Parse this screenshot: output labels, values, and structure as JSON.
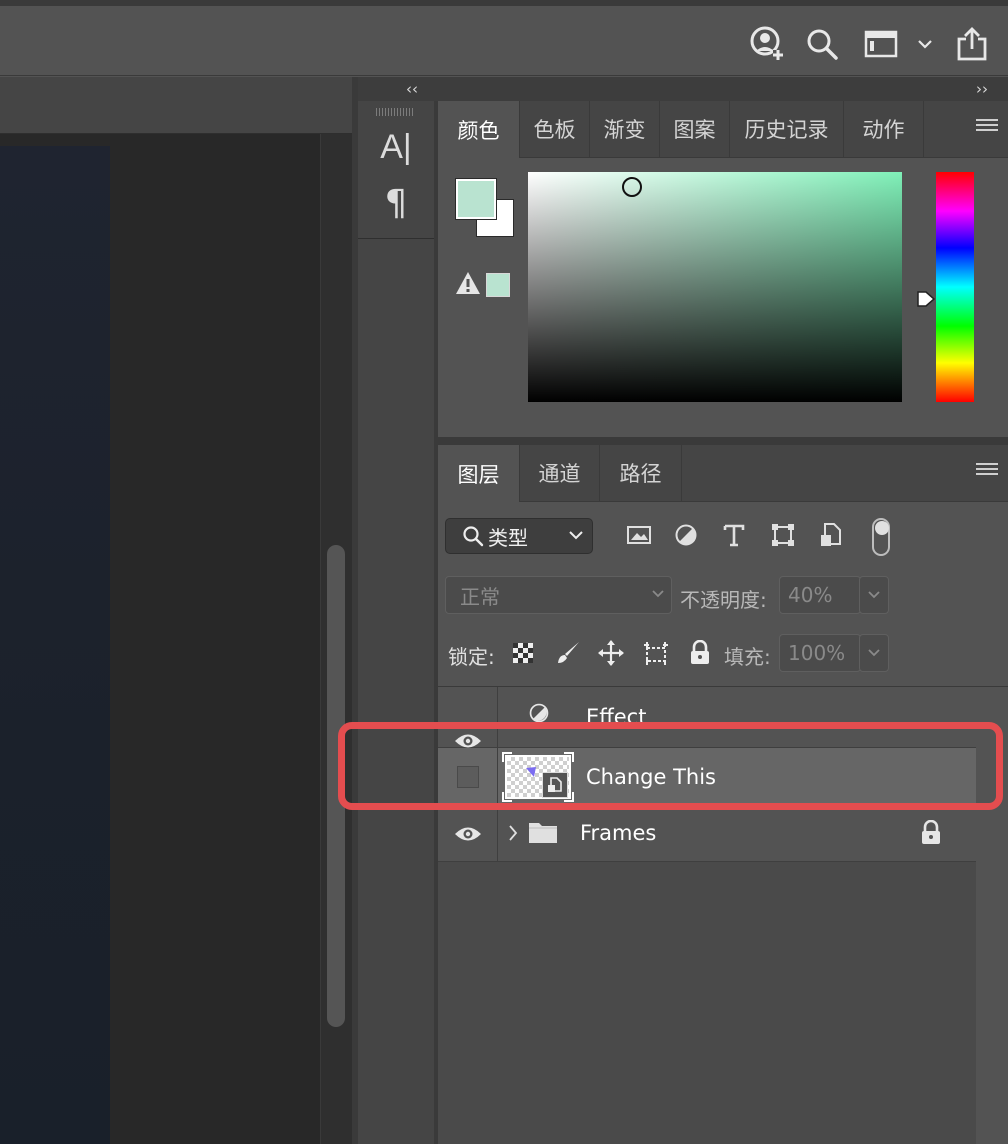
{
  "topbar": {
    "icons": [
      "user-add-icon",
      "search-icon",
      "workspace-icon",
      "chevron-down-icon",
      "share-icon"
    ]
  },
  "collapse": {
    "left": "‹‹",
    "right": "››"
  },
  "mini_panel": {
    "char_icon": "A|",
    "para_icon": "¶"
  },
  "color_panel": {
    "tabs": [
      "颜色",
      "色板",
      "渐变",
      "图案",
      "历史记录",
      "动作"
    ],
    "active_tab": "颜色",
    "foreground_color": "#b9e3d0",
    "background_color": "#ffffff",
    "hue_color": "#7ff0b8"
  },
  "layers_panel": {
    "tabs": [
      "图层",
      "通道",
      "路径"
    ],
    "active_tab": "图层",
    "filter_label": "类型",
    "filter_icons": [
      "image-filter-icon",
      "adjustment-filter-icon",
      "type-filter-icon",
      "shape-filter-icon",
      "smart-object-filter-icon"
    ],
    "blend_mode": "正常",
    "opacity_label": "不透明度:",
    "opacity_value": "40%",
    "lock_label": "锁定:",
    "lock_icons": [
      "lock-transparent-icon",
      "lock-image-icon",
      "lock-position-icon",
      "lock-artboard-icon",
      "lock-all-icon"
    ],
    "fill_label": "填充:",
    "fill_value": "100%",
    "layers": [
      {
        "name": "Effect",
        "visible": true,
        "type": "adjustment"
      },
      {
        "name": "Change This",
        "visible": false,
        "type": "smart-object",
        "selected": true
      },
      {
        "name": "Frames",
        "visible": true,
        "type": "group",
        "locked": true
      }
    ]
  },
  "highlight_color": "#e44d4f"
}
